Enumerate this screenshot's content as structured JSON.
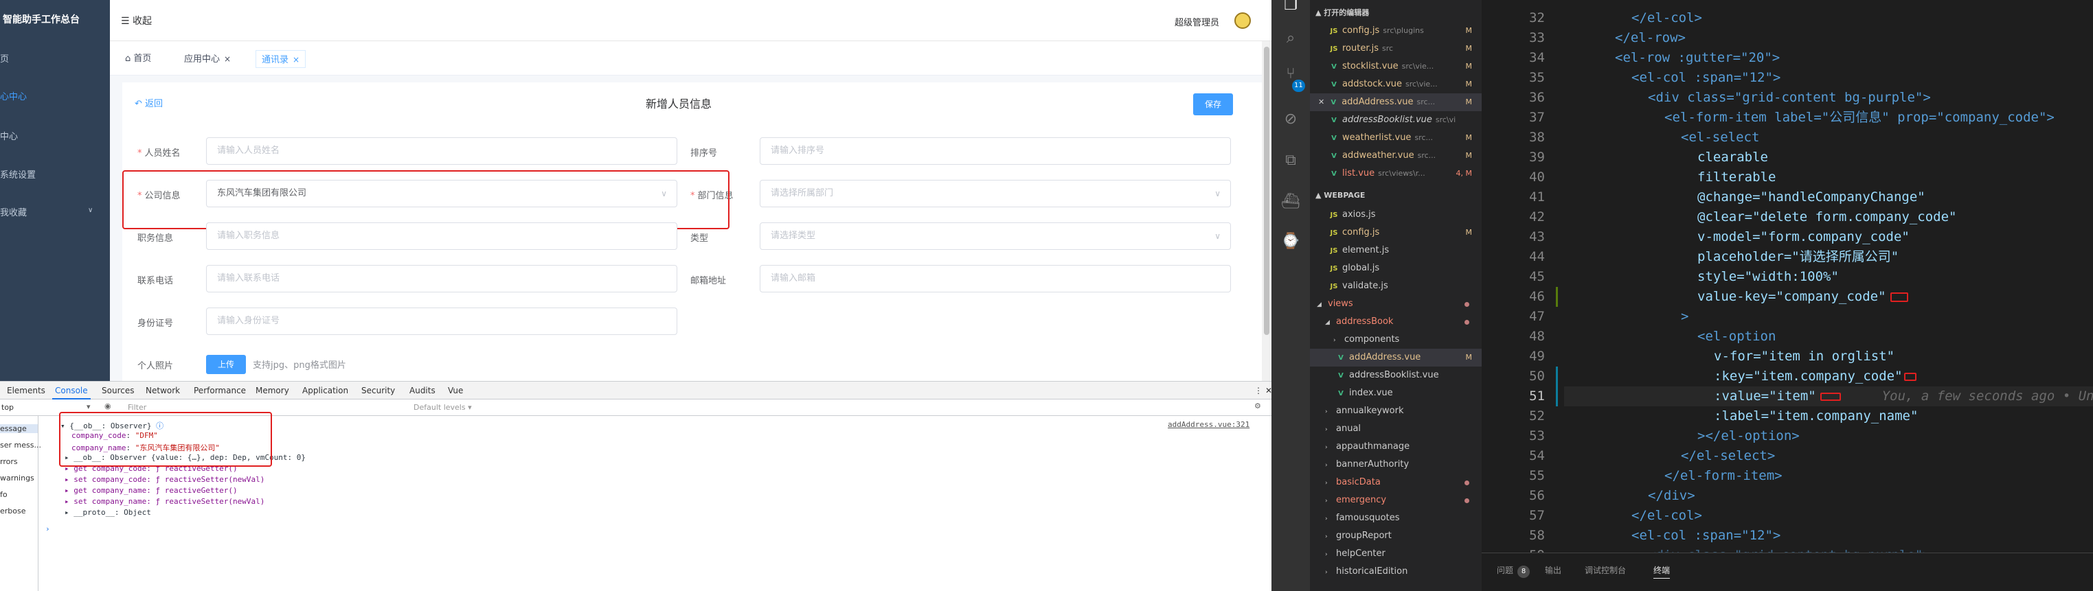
{
  "browser": {
    "sidebar": {
      "brand": "智能助手工作总台",
      "items": [
        "页",
        "心中心",
        "中心",
        "系统设置",
        "我收藏"
      ]
    },
    "topbar": {
      "collapse": "收起",
      "admin": "超级管理员"
    },
    "tags": [
      {
        "label": "首页"
      },
      {
        "label": "应用中心",
        "close": "×"
      },
      {
        "label": "通讯录",
        "close": "×"
      }
    ],
    "form": {
      "back": "返回",
      "title": "新增人员信息",
      "save": "保存",
      "fields": {
        "name": {
          "label": "人员姓名",
          "placeholder": "请输入人员姓名"
        },
        "sort": {
          "label": "排序号",
          "placeholder": "请输入排序号"
        },
        "company": {
          "label": "公司信息",
          "value": "东风汽车集团有限公司"
        },
        "dept": {
          "label": "部门信息",
          "placeholder": "请选择所属部门"
        },
        "position": {
          "label": "职务信息",
          "placeholder": "请输入职务信息"
        },
        "type": {
          "label": "类型",
          "placeholder": "请选择类型"
        },
        "phone": {
          "label": "联系电话",
          "placeholder": "请输入联系电话"
        },
        "email": {
          "label": "邮箱地址",
          "placeholder": "请输入邮箱"
        },
        "idcard": {
          "label": "身份证号",
          "placeholder": "请输入身份证号"
        },
        "photo": {
          "label": "个人照片",
          "upload": "上传",
          "tip": "支持jpg、png格式图片"
        }
      }
    },
    "devtools": {
      "tabs": [
        "Elements",
        "Console",
        "Sources",
        "Network",
        "Performance",
        "Memory",
        "Application",
        "Security",
        "Audits",
        "Vue"
      ],
      "context": "top",
      "filter": "Filter",
      "levels": "Default levels ▾",
      "side": [
        "essage",
        "ser mess...",
        "rrors",
        "warnings",
        "fo",
        "erbose"
      ],
      "source_link": "addAddress.vue:321",
      "lines": {
        "l1_head": "{__ob__: Observer}",
        "l2_key": "company_code",
        "l2_val": "\"DFM\"",
        "l3_key": "company_name",
        "l3_val": "\"东风汽车集团有限公司\"",
        "l4": "▸ __ob__: Observer {value: {…}, dep: Dep, vmCount: 0}",
        "l5": "▸ get company_code: ƒ reactiveGetter()",
        "l6": "▸ set company_code: ƒ reactiveSetter(newVal)",
        "l7": "▸ get company_name: ƒ reactiveGetter()",
        "l8": "▸ set company_name: ƒ reactiveSetter(newVal)",
        "l9": "▸ __proto__: Object",
        "prompt": "›"
      }
    }
  },
  "vscode": {
    "activity_badge": "11",
    "open_editors": {
      "title": "▲ 打开的编辑器",
      "files": [
        {
          "icon": "JS",
          "name": "config.js",
          "path": "src\\plugins",
          "status": "M"
        },
        {
          "icon": "JS",
          "name": "router.js",
          "path": "src",
          "status": "M"
        },
        {
          "icon": "V",
          "name": "stocklist.vue",
          "path": "src\\vie...",
          "status": "M"
        },
        {
          "icon": "V",
          "name": "addstock.vue",
          "path": "src\\vie...",
          "status": "M"
        },
        {
          "icon": "V",
          "name": "addAddress.vue",
          "path": "src...",
          "status": "M"
        },
        {
          "icon": "V",
          "name": "addressBooklist.vue",
          "path": "src\\vi",
          "status": ""
        },
        {
          "icon": "V",
          "name": "weatherlist.vue",
          "path": "src...",
          "status": "M"
        },
        {
          "icon": "V",
          "name": "addweather.vue",
          "path": "src...",
          "status": "M"
        },
        {
          "icon": "V",
          "name": "list.vue",
          "path": "src\\views\\r...",
          "status": "4, M"
        }
      ]
    },
    "webpage": {
      "title": "▲ WEBPAGE",
      "files": [
        {
          "icon": "JS",
          "name": "axios.js"
        },
        {
          "icon": "JS",
          "name": "config.js",
          "status": "M"
        },
        {
          "icon": "JS",
          "name": "element.js"
        },
        {
          "icon": "JS",
          "name": "global.js"
        },
        {
          "icon": "JS",
          "name": "validate.js"
        },
        {
          "name": "views"
        },
        {
          "name": "addressBook"
        },
        {
          "name": "components"
        },
        {
          "icon": "V",
          "name": "addAddress.vue",
          "status": "M"
        },
        {
          "icon": "V",
          "name": "addressBooklist.vue"
        },
        {
          "icon": "V",
          "name": "index.vue"
        },
        {
          "name": "annualkeywork"
        },
        {
          "name": "anual"
        },
        {
          "name": "appauthmanage"
        },
        {
          "name": "bannerAuthority"
        },
        {
          "name": "basicData"
        },
        {
          "name": "emergency"
        },
        {
          "name": "famousquotes"
        },
        {
          "name": "groupReport"
        },
        {
          "name": "helpCenter"
        },
        {
          "name": "historicalEdition"
        }
      ]
    },
    "editor": {
      "lines": [
        {
          "n": "32",
          "text": "</el-col>"
        },
        {
          "n": "33",
          "text": "</el-row>"
        },
        {
          "n": "34",
          "text": "<el-row :gutter=\"20\">"
        },
        {
          "n": "35",
          "text": "<el-col :span=\"12\">"
        },
        {
          "n": "36",
          "text": "<div class=\"grid-content bg-purple\">"
        },
        {
          "n": "37",
          "text": "<el-form-item label=\"公司信息\" prop=\"company_code\">"
        },
        {
          "n": "38",
          "text": "<el-select"
        },
        {
          "n": "39",
          "text": "clearable"
        },
        {
          "n": "40",
          "text": "filterable"
        },
        {
          "n": "41",
          "text": "@change=\"handleCompanyChange\""
        },
        {
          "n": "42",
          "text": "@clear=\"delete form.company_code\""
        },
        {
          "n": "43",
          "text": "v-model=\"form.company_code\""
        },
        {
          "n": "44",
          "text": "placeholder=\"请选择所属公司\""
        },
        {
          "n": "45",
          "text": "style=\"width:100%\""
        },
        {
          "n": "46",
          "text": "value-key=\"company_code\""
        },
        {
          "n": "47",
          "text": ">"
        },
        {
          "n": "48",
          "text": "<el-option"
        },
        {
          "n": "49",
          "text": "v-for=\"item in orglist\""
        },
        {
          "n": "50",
          "text": ":key=\"item.company_code\""
        },
        {
          "n": "51",
          "text": ":value=\"item\""
        },
        {
          "n": "52",
          "text": ":label=\"item.company_name\""
        },
        {
          "n": "53",
          "text": "></el-option>"
        },
        {
          "n": "54",
          "text": "</el-select>"
        },
        {
          "n": "55",
          "text": "</el-form-item>"
        },
        {
          "n": "56",
          "text": "</div>"
        },
        {
          "n": "57",
          "text": "</el-col>"
        },
        {
          "n": "58",
          "text": "<el-col :span=\"12\">"
        },
        {
          "n": "59",
          "text": "<div class=\"grid-content bg-purple\">"
        }
      ],
      "blame": "You, a few seconds ago • Uncom"
    },
    "panel": {
      "tabs": [
        "问题",
        "输出",
        "调试控制台",
        "终端"
      ],
      "problems_count": "8"
    }
  }
}
